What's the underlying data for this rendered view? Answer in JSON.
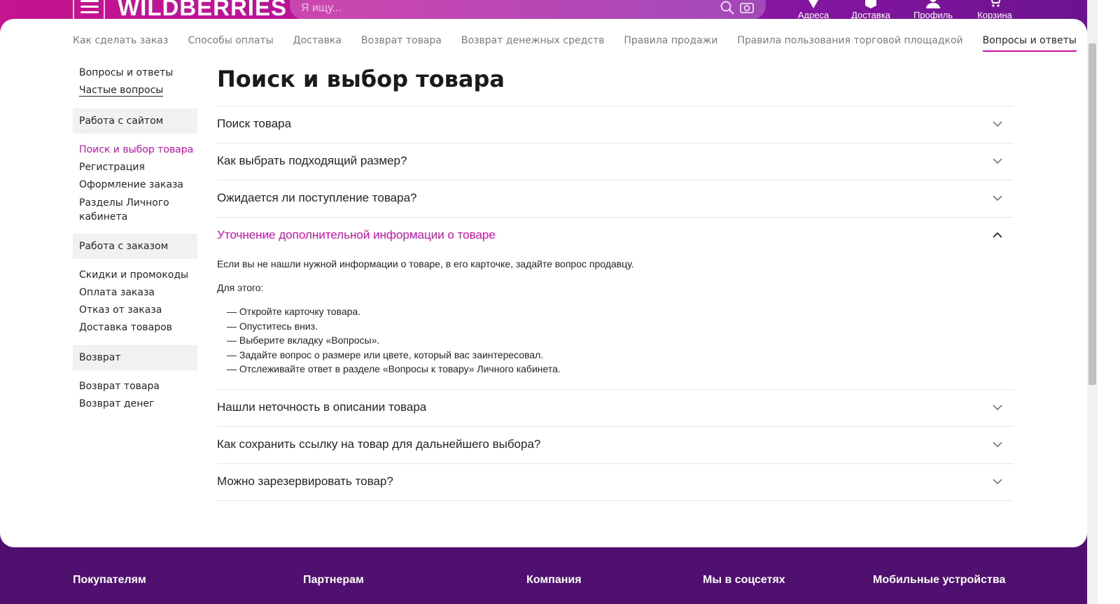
{
  "header": {
    "logo": "WILDBERRIES",
    "search_placeholder": "Я ищу...",
    "nav": [
      {
        "label": "Адреса",
        "icon": "location-pin-icon"
      },
      {
        "label": "Доставка",
        "icon": "box-icon"
      },
      {
        "label": "Профиль",
        "icon": "profile-icon"
      },
      {
        "label": "Корзина",
        "icon": "cart-icon"
      }
    ]
  },
  "tabs": [
    "Как сделать заказ",
    "Способы оплаты",
    "Доставка",
    "Возврат товара",
    "Возврат денежных средств",
    "Правила продажи",
    "Правила пользования торговой площадкой",
    "Вопросы и ответы"
  ],
  "active_tab": "Вопросы и ответы",
  "sidebar": {
    "top_links": [
      "Вопросы и ответы",
      "Частые вопросы"
    ],
    "groups": [
      {
        "title": "Работа с сайтом",
        "items": [
          "Поиск и выбор товара",
          "Регистрация",
          "Оформление заказа",
          "Разделы Личного кабинета"
        ]
      },
      {
        "title": "Работа с заказом",
        "items": [
          "Скидки и промокоды",
          "Оплата заказа",
          "Отказ от заказа",
          "Доставка товаров"
        ]
      },
      {
        "title": "Возврат",
        "items": [
          "Возврат товара",
          "Возврат денег"
        ]
      }
    ],
    "active_item": "Поиск и выбор товара"
  },
  "main": {
    "title": "Поиск и выбор товара",
    "faq_before": [
      "Поиск товара",
      "Как выбрать подходящий размер?",
      "Ожидается ли поступление товара?"
    ],
    "faq_open": {
      "question": "Уточнение дополнительной информации о товаре",
      "p1": "Если вы не нашли нужной информации о товаре, в его карточке, задайте вопрос продавцу.",
      "p2": "Для этого:",
      "steps": [
        "— Откройте карточку товара.",
        "— Опуститесь вниз.",
        "— Выберите вкладку «Вопросы».",
        "— Задайте вопрос о размере или цвете, который вас заинтересовал.",
        "— Отслеживайте ответ в разделе «Вопросы к товару» Личного кабинета."
      ]
    },
    "faq_after": [
      "Нашли неточность в описании товара",
      "Как сохранить ссылку на товар для дальнейшего выбора?",
      "Можно зарезервировать товар?"
    ]
  },
  "footer": {
    "columns": [
      "Покупателям",
      "Партнерам",
      "Компания",
      "Мы в соцсетях",
      "Мобильные устройства"
    ]
  },
  "colors": {
    "accent": "#cb11ab",
    "footer_bg": "#4f1070",
    "header_start": "#c4148f",
    "header_end": "#6a148e"
  }
}
